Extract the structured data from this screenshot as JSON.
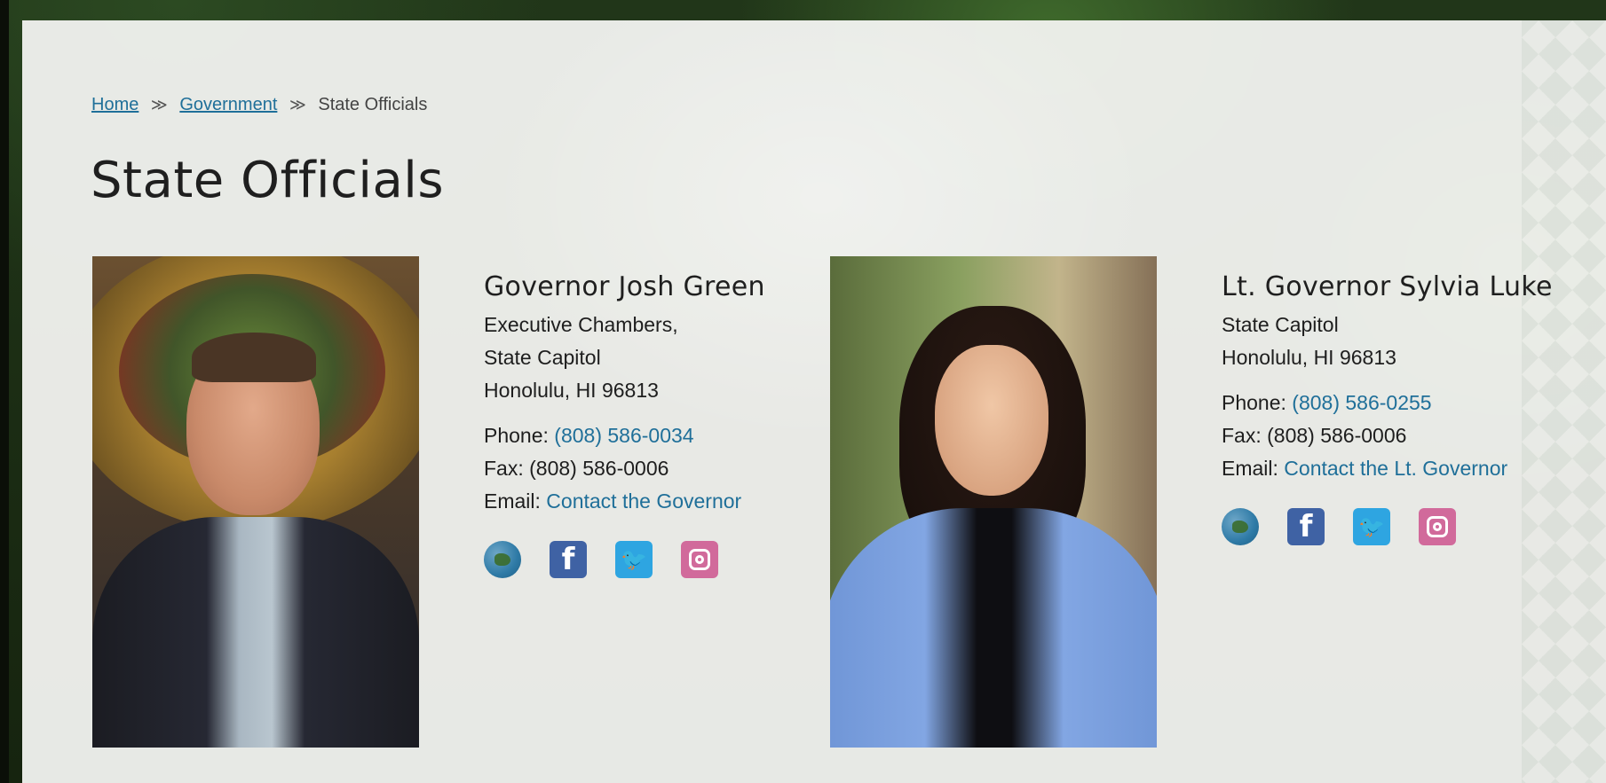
{
  "breadcrumb": {
    "home": "Home",
    "government": "Government",
    "current": "State Officials",
    "separator": "≫"
  },
  "page": {
    "title": "State Officials"
  },
  "officials": [
    {
      "name": "Governor Josh Green",
      "address": [
        "Executive Chambers,",
        "State Capitol",
        "Honolulu, HI 96813"
      ],
      "phone_label": "Phone:",
      "phone": "(808) 586-0034",
      "fax_label": "Fax:",
      "fax": "(808) 586-0006",
      "email_label": "Email:",
      "email_link": "Contact the Governor",
      "social": [
        "globe-icon",
        "facebook-icon",
        "twitter-icon",
        "instagram-icon"
      ]
    },
    {
      "name": "Lt. Governor Sylvia Luke",
      "address": [
        "State Capitol",
        "Honolulu, HI 96813"
      ],
      "phone_label": "Phone:",
      "phone": "(808) 586-0255",
      "fax_label": "Fax:",
      "fax": "(808) 586-0006",
      "email_label": "Email:",
      "email_link": "Contact the Lt. Governor",
      "social": [
        "globe-icon",
        "facebook-icon",
        "twitter-icon",
        "instagram-icon"
      ]
    }
  ],
  "icons": {
    "facebook_glyph": "f",
    "twitter_glyph": "🐦"
  },
  "colors": {
    "link": "#1f6f99",
    "facebook": "#3f62a4",
    "twitter": "#2ea5e1",
    "instagram": "#d16a9b",
    "globe": "#2e7aa6"
  }
}
